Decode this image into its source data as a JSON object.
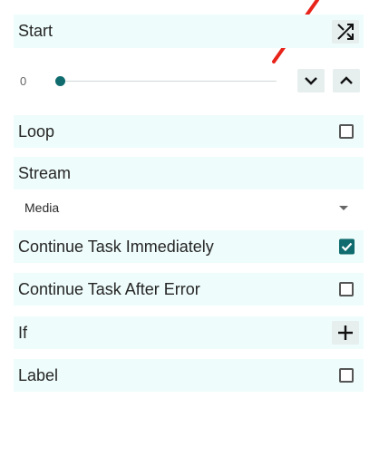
{
  "start": {
    "label": "Start",
    "button_icon": "shuffle-icon"
  },
  "slider": {
    "value_text": "0",
    "value_fraction": 0.0,
    "down_icon": "chevron-down-icon",
    "up_icon": "chevron-up-icon"
  },
  "loop": {
    "label": "Loop",
    "checked": false
  },
  "stream": {
    "label": "Stream",
    "selected": "Media"
  },
  "continue_immediately": {
    "label": "Continue Task Immediately",
    "checked": true
  },
  "continue_after_error": {
    "label": "Continue Task After Error",
    "checked": false
  },
  "if": {
    "label": "If",
    "button_icon": "plus-icon"
  },
  "label_option": {
    "label": "Label",
    "checked": false
  },
  "colors": {
    "accent": "#0f6b6e",
    "row_bg": "#eefcfb",
    "annotation": "#e8231a"
  }
}
